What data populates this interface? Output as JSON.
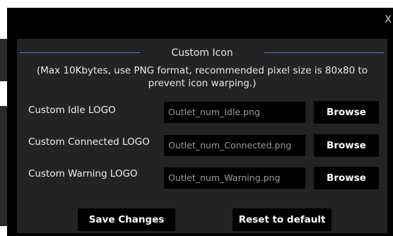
{
  "dialog": {
    "close_label": "X",
    "section_title": "Custom Icon",
    "description": "(Max 10Kbytes, use PNG format, recommended pixel size is 80x80 to prevent icon warping.)",
    "rows": [
      {
        "label": "Custom Idle LOGO",
        "value": "Outlet_num_Idle.png",
        "button": "Browse"
      },
      {
        "label": "Custom Connected LOGO",
        "value": "Outlet_num_Connected.png",
        "button": "Browse"
      },
      {
        "label": "Custom Warning LOGO",
        "value": "Outlet_num_Warning.png",
        "button": "Browse"
      }
    ],
    "save_label": "Save Changes",
    "reset_label": "Reset to default"
  },
  "colors": {
    "accent_line": "#3d88d6",
    "panel": "#232323",
    "modal": "#000000"
  }
}
